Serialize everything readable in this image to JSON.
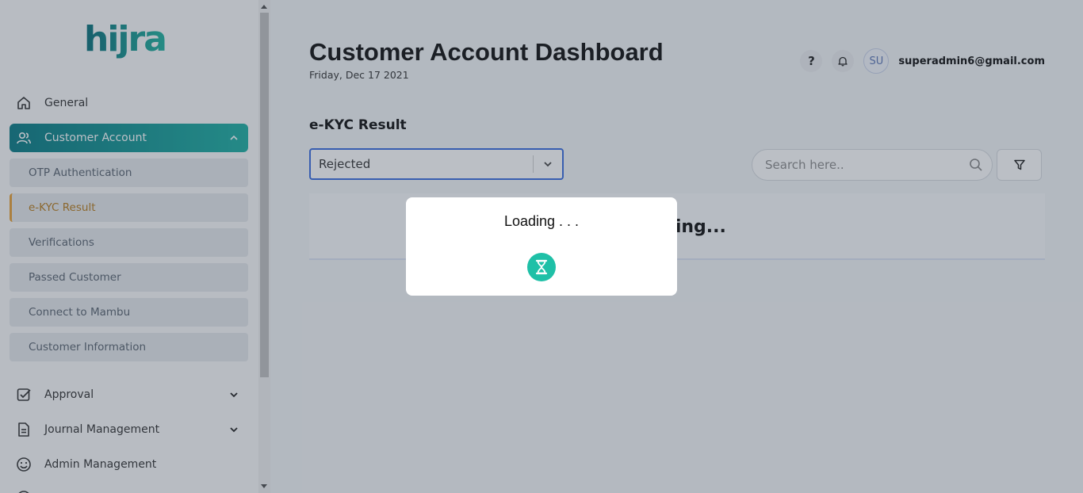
{
  "sidebar": {
    "logo_text": "hijra",
    "items": [
      {
        "label": "General",
        "icon": "home-icon"
      },
      {
        "label": "Customer Account",
        "icon": "users-icon",
        "expanded": true
      },
      {
        "label": "Approval",
        "icon": "check-square-icon"
      },
      {
        "label": "Journal Management",
        "icon": "document-icon"
      },
      {
        "label": "Admin Management",
        "icon": "smiley-icon"
      }
    ],
    "sub_items": [
      {
        "label": "OTP Authentication"
      },
      {
        "label": "e-KYC Result",
        "active": true
      },
      {
        "label": "Verifications"
      },
      {
        "label": "Passed Customer"
      },
      {
        "label": "Connect to Mambu"
      },
      {
        "label": "Customer Information"
      }
    ]
  },
  "header": {
    "title": "Customer Account Dashboard",
    "date": "Friday, Dec 17 2021",
    "help_label": "?",
    "avatar_initials": "SU",
    "user_email": "superadmin6@gmail.com"
  },
  "main": {
    "section_title": "e-KYC Result",
    "status_select": {
      "value": "Rejected"
    },
    "search": {
      "placeholder": "Search here.."
    },
    "table_loading_text": "Loading..."
  },
  "modal": {
    "text": "Loading . . .",
    "icon": "hourglass-icon"
  },
  "colors": {
    "brand_teal": "#1fb0a3",
    "brand_teal_dark": "#0b7c85",
    "active_sub_accent": "#e7a23a",
    "select_border": "#3d6fe0"
  }
}
